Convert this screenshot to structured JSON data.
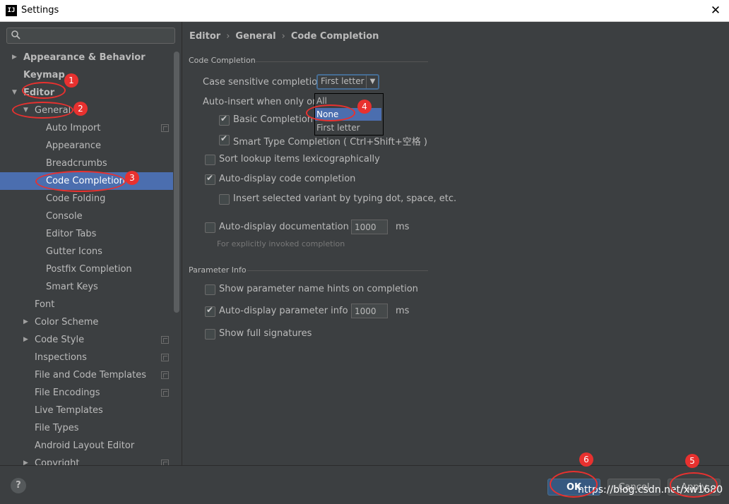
{
  "window": {
    "title": "Settings",
    "app_icon_text": "IJ",
    "close_glyph": "✕"
  },
  "search": {
    "placeholder": "",
    "icon": "search-icon"
  },
  "tree": [
    {
      "label": "Appearance & Behavior",
      "indent": 0,
      "arrow": "▶",
      "bold": true,
      "proj": false
    },
    {
      "label": "Keymap",
      "indent": 0,
      "arrow": "",
      "bold": true,
      "proj": false
    },
    {
      "label": "Editor",
      "indent": 0,
      "arrow": "▼",
      "bold": true,
      "proj": false
    },
    {
      "label": "General",
      "indent": 1,
      "arrow": "▼",
      "bold": false,
      "proj": false
    },
    {
      "label": "Auto Import",
      "indent": 2,
      "arrow": "",
      "bold": false,
      "proj": true
    },
    {
      "label": "Appearance",
      "indent": 2,
      "arrow": "",
      "bold": false,
      "proj": false
    },
    {
      "label": "Breadcrumbs",
      "indent": 2,
      "arrow": "",
      "bold": false,
      "proj": false
    },
    {
      "label": "Code Completion",
      "indent": 2,
      "arrow": "",
      "bold": false,
      "proj": false,
      "selected": true
    },
    {
      "label": "Code Folding",
      "indent": 2,
      "arrow": "",
      "bold": false,
      "proj": false
    },
    {
      "label": "Console",
      "indent": 2,
      "arrow": "",
      "bold": false,
      "proj": false
    },
    {
      "label": "Editor Tabs",
      "indent": 2,
      "arrow": "",
      "bold": false,
      "proj": false
    },
    {
      "label": "Gutter Icons",
      "indent": 2,
      "arrow": "",
      "bold": false,
      "proj": false
    },
    {
      "label": "Postfix Completion",
      "indent": 2,
      "arrow": "",
      "bold": false,
      "proj": false
    },
    {
      "label": "Smart Keys",
      "indent": 2,
      "arrow": "",
      "bold": false,
      "proj": false
    },
    {
      "label": "Font",
      "indent": 1,
      "arrow": "",
      "bold": false,
      "proj": false
    },
    {
      "label": "Color Scheme",
      "indent": 1,
      "arrow": "▶",
      "bold": false,
      "proj": false
    },
    {
      "label": "Code Style",
      "indent": 1,
      "arrow": "▶",
      "bold": false,
      "proj": true
    },
    {
      "label": "Inspections",
      "indent": 1,
      "arrow": "",
      "bold": false,
      "proj": true
    },
    {
      "label": "File and Code Templates",
      "indent": 1,
      "arrow": "",
      "bold": false,
      "proj": true
    },
    {
      "label": "File Encodings",
      "indent": 1,
      "arrow": "",
      "bold": false,
      "proj": true
    },
    {
      "label": "Live Templates",
      "indent": 1,
      "arrow": "",
      "bold": false,
      "proj": false
    },
    {
      "label": "File Types",
      "indent": 1,
      "arrow": "",
      "bold": false,
      "proj": false
    },
    {
      "label": "Android Layout Editor",
      "indent": 1,
      "arrow": "",
      "bold": false,
      "proj": false
    },
    {
      "label": "Copyright",
      "indent": 1,
      "arrow": "▶",
      "bold": false,
      "proj": true
    }
  ],
  "breadcrumb": [
    "Editor",
    "General",
    "Code Completion"
  ],
  "breadcrumb_sep": "›",
  "code_completion": {
    "section_title": "Code Completion",
    "case_label": "Case sensitive completion:",
    "case_value": "First letter",
    "case_options": [
      "All",
      "None",
      "First letter"
    ],
    "case_highlighted": "None",
    "auto_insert_label": "Auto-insert when only one",
    "basic_label": "Basic Completion (",
    "basic_checked": true,
    "smart_label": "Smart Type Completion ( Ctrl+Shift+空格 )",
    "smart_checked": true,
    "sort_label": "Sort lookup items lexicographically",
    "sort_checked": false,
    "autodisplay_label": "Auto-display code completion",
    "autodisplay_checked": true,
    "insert_variant_label": "Insert selected variant by typing dot, space, etc.",
    "insert_variant_checked": false,
    "doc_label": "Auto-display documentation in",
    "doc_checked": false,
    "doc_ms": "1000",
    "doc_unit": "ms",
    "doc_hint": "For explicitly invoked completion"
  },
  "parameter_info": {
    "section_title": "Parameter Info",
    "hints_label": "Show parameter name hints on completion",
    "hints_checked": false,
    "autodisplay_label": "Auto-display parameter info in",
    "autodisplay_checked": true,
    "ms": "1000",
    "unit": "ms",
    "signatures_label": "Show full signatures",
    "signatures_checked": false
  },
  "buttons": {
    "help": "?",
    "ok": "OK",
    "cancel": "Cancel",
    "apply": "Apply"
  },
  "watermark": "https://blog.csdn.net/xw1680",
  "annotations": [
    "1",
    "2",
    "3",
    "4",
    "5",
    "6"
  ],
  "colors": {
    "selection": "#4b6eaf",
    "annotation": "#e8312f",
    "ok_button": "#365880"
  }
}
